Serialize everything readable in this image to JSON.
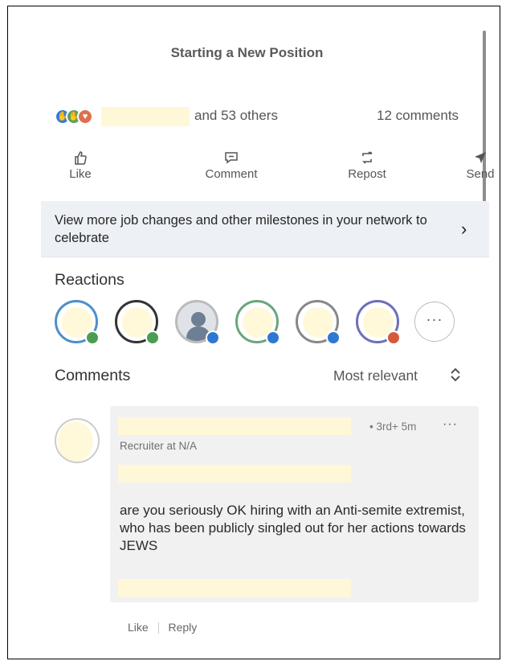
{
  "post": {
    "title": "Starting a New Position"
  },
  "summary": {
    "reaction_icons": [
      "clap-icon",
      "celebrate-icon",
      "love-icon"
    ],
    "others_text": "and 53 others",
    "comments_text": "12 comments"
  },
  "actions": [
    {
      "label": "Like",
      "icon": "thumbs-up-icon"
    },
    {
      "label": "Comment",
      "icon": "comment-icon"
    },
    {
      "label": "Repost",
      "icon": "repost-icon"
    },
    {
      "label": "Send",
      "icon": "send-icon"
    }
  ],
  "banner": {
    "text": "View more job changes and other milestones in your network to celebrate",
    "chevron": "›"
  },
  "reactions": {
    "heading": "Reactions",
    "more_label": "···"
  },
  "comments": {
    "heading": "Comments",
    "sort_label": "Most relevant",
    "items": [
      {
        "meta": "• 3rd+ 5m",
        "more": "···",
        "headline": "Recruiter at N/A",
        "text": "are you seriously OK hiring with an Anti-semite extremist, who has been publicly singled out for her actions towards JEWS",
        "like_label": "Like",
        "reply_label": "Reply"
      }
    ]
  },
  "colors": {
    "banner_bg": "#edf0f5",
    "comment_bg": "#f1f1f1",
    "redaction": "#fff8d8",
    "reaction_green": "#4b9d52",
    "reaction_blue": "#2f78d1",
    "reaction_red": "#d65a3a"
  }
}
